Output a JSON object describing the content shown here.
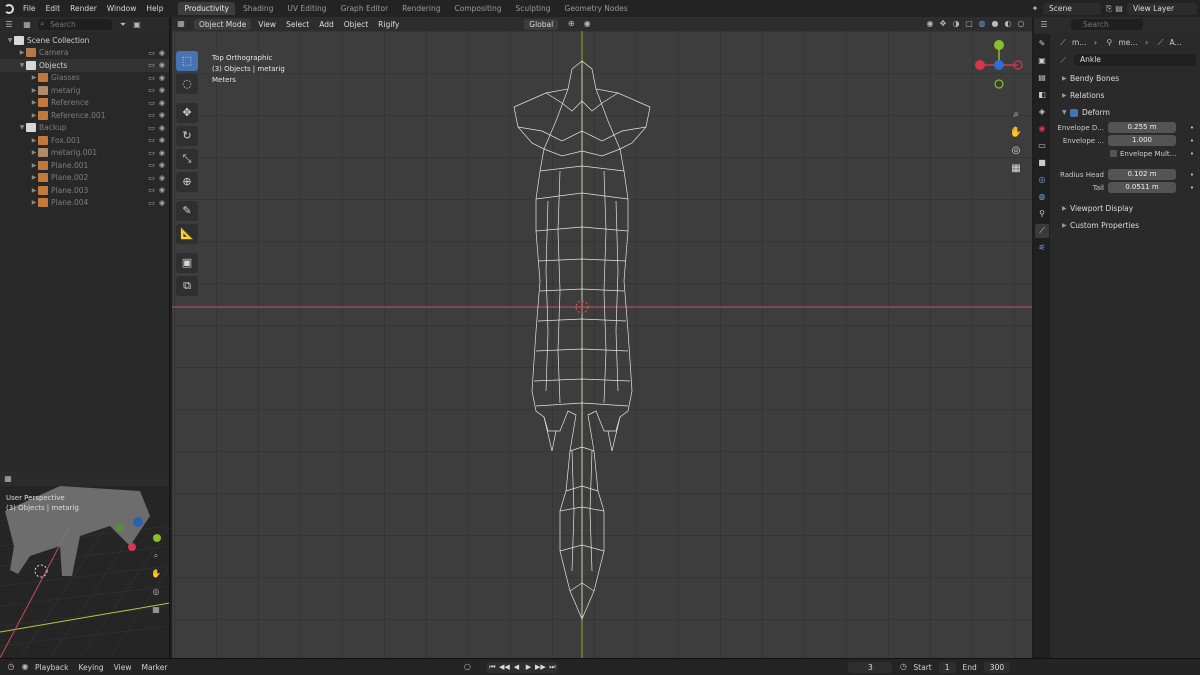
{
  "topbar": {
    "menu": [
      "File",
      "Edit",
      "Render",
      "Window",
      "Help"
    ],
    "workspaces": [
      "Productivity",
      "Shading",
      "UV Editing",
      "Graph Editor",
      "Rendering",
      "Compositing",
      "Sculpting",
      "Geometry Nodes"
    ],
    "active_workspace": "Productivity",
    "scene": "Scene",
    "view_layer": "View Layer"
  },
  "outliner": {
    "search_placeholder": "Search",
    "rows": [
      {
        "label": "Scene Collection",
        "indent": 0,
        "type": "collection",
        "dim": false
      },
      {
        "label": "Camera",
        "indent": 1,
        "type": "camera",
        "dim": true
      },
      {
        "label": "Objects",
        "indent": 1,
        "type": "collection",
        "dim": false
      },
      {
        "label": "Glasses",
        "indent": 2,
        "type": "object",
        "dim": true
      },
      {
        "label": "metarig",
        "indent": 2,
        "type": "armature",
        "dim": true
      },
      {
        "label": "Reference",
        "indent": 2,
        "type": "object",
        "dim": true
      },
      {
        "label": "Reference.001",
        "indent": 2,
        "type": "object",
        "dim": true
      },
      {
        "label": "Backup",
        "indent": 1,
        "type": "collection",
        "dim": true
      },
      {
        "label": "Fox.001",
        "indent": 2,
        "type": "object",
        "dim": true
      },
      {
        "label": "metarig.001",
        "indent": 2,
        "type": "armature",
        "dim": true
      },
      {
        "label": "Plane.001",
        "indent": 2,
        "type": "object",
        "dim": true
      },
      {
        "label": "Plane.002",
        "indent": 2,
        "type": "object",
        "dim": true
      },
      {
        "label": "Plane.003",
        "indent": 2,
        "type": "object",
        "dim": true
      },
      {
        "label": "Plane.004",
        "indent": 2,
        "type": "object",
        "dim": true
      }
    ]
  },
  "preview": {
    "line1": "User Perspective",
    "line2": "(3) Objects | metarig"
  },
  "viewport": {
    "mode": "Object Mode",
    "menus": [
      "View",
      "Select",
      "Add",
      "Object",
      "Rigify"
    ],
    "orientation": "Global",
    "info_line1": "Top Orthographic",
    "info_line2": "(3) Objects | metarig",
    "info_line3": "Meters"
  },
  "properties": {
    "search_placeholder": "Search",
    "crumbs": [
      "m...",
      "me...",
      "A..."
    ],
    "bone_name": "Ankle",
    "panels": {
      "bendy_bones": "Bendy Bones",
      "relations": "Relations",
      "deform": "Deform",
      "viewport_display": "Viewport Display",
      "custom_properties": "Custom Properties"
    },
    "fields": {
      "envelope_distance_label": "Envelope D...",
      "envelope_distance": "0.255 m",
      "envelope_weight_label": "Envelope ...",
      "envelope_weight": "1.000",
      "envelope_multiply": "Envelope Mult...",
      "radius_head_label": "Radius Head",
      "radius_head": "0.102 m",
      "tail_label": "Tail",
      "tail": "0.0511 m"
    }
  },
  "timeline": {
    "menus": [
      "Playback",
      "Keying",
      "View",
      "Marker"
    ],
    "current_frame": "3",
    "start_label": "Start",
    "start": "1",
    "end_label": "End",
    "end": "300"
  }
}
